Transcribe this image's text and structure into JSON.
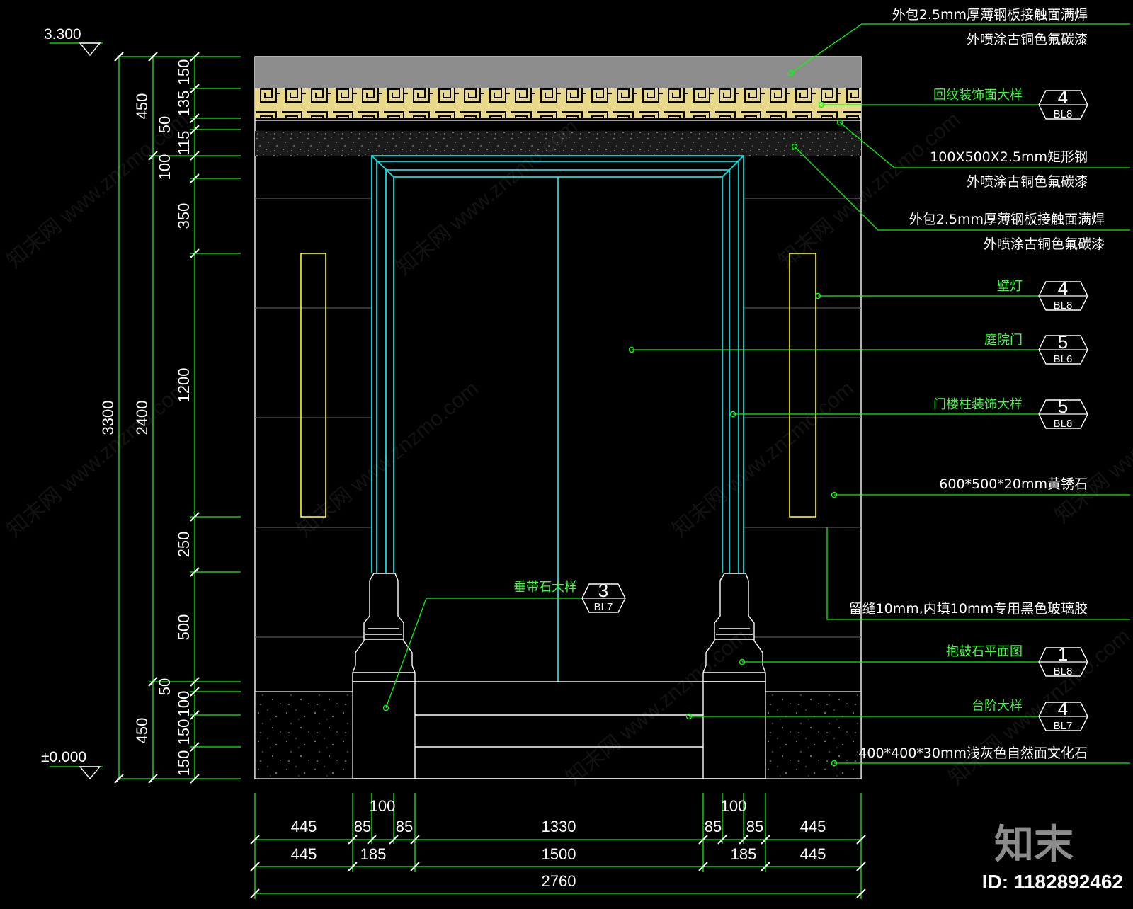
{
  "levels": {
    "top": "3.300",
    "bottom": "±0.000"
  },
  "dims_left_outer": {
    "total": "3300"
  },
  "dims_left_mid": {
    "top": "450",
    "middle": "2400",
    "bottom": "450"
  },
  "dims_left_inner": [
    "150",
    "135",
    "50",
    "115",
    "100",
    "350",
    "1200",
    "250",
    "500",
    "50",
    "100",
    "150",
    "150"
  ],
  "dims_bottom_row1": [
    "445",
    "85",
    "100",
    "85",
    "1330",
    "85",
    "100",
    "85",
    "445"
  ],
  "dims_bottom_row2": [
    "445",
    "185",
    "1500",
    "185",
    "445"
  ],
  "dims_bottom_total": "2760",
  "notes": {
    "top_a": "外包2.5mm厚薄钢板接触面满焊",
    "top_b": "外喷涂古铜色氟碳漆",
    "huiwen": "回纹装饰面大样",
    "steel_a": "100X500X2.5mm矩形钢",
    "steel_b": "外喷涂古铜色氟碳漆",
    "mid_a": "外包2.5mm厚薄钢板接触面满焊",
    "mid_b": "外喷涂古铜色氟碳漆",
    "lamp": "壁灯",
    "door": "庭院门",
    "post": "门楼柱装饰大样",
    "stone": "600*500*20mm黄锈石",
    "joint": "留缝10mm,内填10mm专用黑色玻璃胶",
    "base": "抱鼓石平面图",
    "step": "台阶大样",
    "culture": "400*400*30mm浅灰色自然面文化石",
    "chuidai": "垂带石大样"
  },
  "callouts": {
    "huiwen": {
      "num": "4",
      "ref": "BL8"
    },
    "lamp": {
      "num": "4",
      "ref": "BL8"
    },
    "door": {
      "num": "5",
      "ref": "BL6"
    },
    "post": {
      "num": "5",
      "ref": "BL8"
    },
    "base": {
      "num": "1",
      "ref": "BL8"
    },
    "step": {
      "num": "4",
      "ref": "BL7"
    },
    "chuidai": {
      "num": "3",
      "ref": "BL7"
    }
  },
  "watermark": {
    "brand": "知末",
    "id": "ID: 1182892462",
    "site": "知末网 www.znzmo.com"
  },
  "colors": {
    "background": "#000000",
    "dim": "#00ff00",
    "wall": "#ffffff",
    "frame": "#00e5e5",
    "lamp": "#ffff00",
    "band": "#e8d98a",
    "cap": "#8c8c8c"
  }
}
